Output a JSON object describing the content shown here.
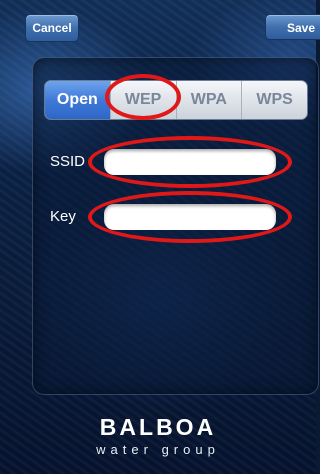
{
  "nav": {
    "cancel_label": "Cancel",
    "save_label": "Save"
  },
  "security_tabs": [
    {
      "label": "Open",
      "selected": true
    },
    {
      "label": "WEP",
      "selected": false
    },
    {
      "label": "WPA",
      "selected": false
    },
    {
      "label": "WPS",
      "selected": false
    }
  ],
  "form": {
    "ssid_label": "SSID",
    "ssid_value": "",
    "key_label": "Key",
    "key_value": ""
  },
  "annotations": {
    "highlight_color": "#e01818"
  },
  "logo": {
    "name": "BALBOA",
    "tagline": "water group"
  }
}
